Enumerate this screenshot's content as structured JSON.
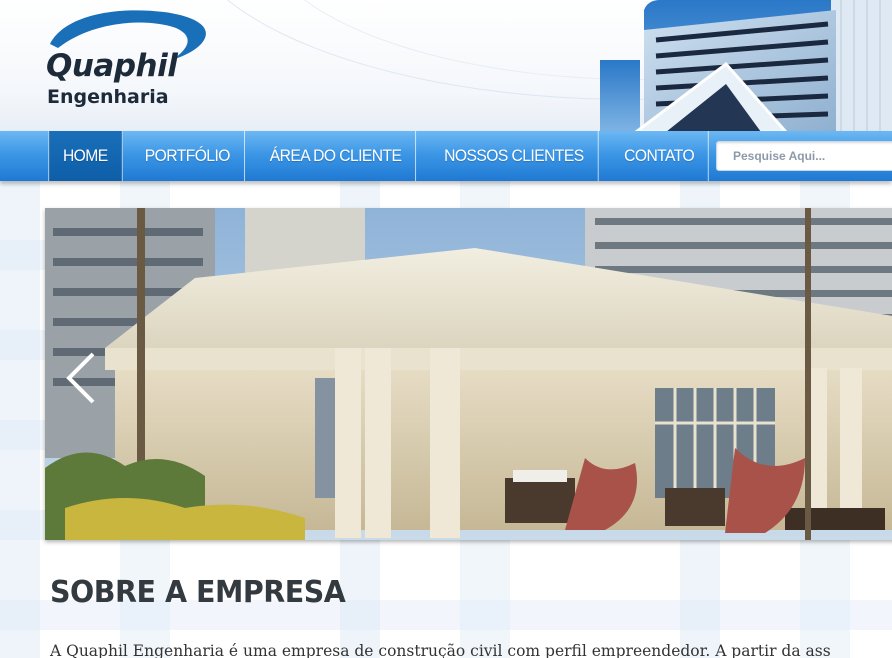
{
  "brand": {
    "name": "Quaphil",
    "subtitle": "Engenharia",
    "accent": "#1f79d3",
    "logo_swoosh": "#1a6fb9"
  },
  "nav": {
    "items": [
      {
        "label": "HOME",
        "active": true
      },
      {
        "label": "PORTFÓLIO",
        "active": false
      },
      {
        "label": "ÁREA DO CLIENTE",
        "active": false
      },
      {
        "label": "NOSSOS CLIENTES",
        "active": false
      },
      {
        "label": "CONTATO",
        "active": false
      }
    ],
    "search_placeholder": "Pesquise Aqui..."
  },
  "slider": {
    "prev_icon": "chevron-left-icon"
  },
  "about": {
    "title": "SOBRE A EMPRESA",
    "text": "A Quaphil Engenharia é uma empresa de construção civil com perfil empreendedor. A partir da ass"
  }
}
